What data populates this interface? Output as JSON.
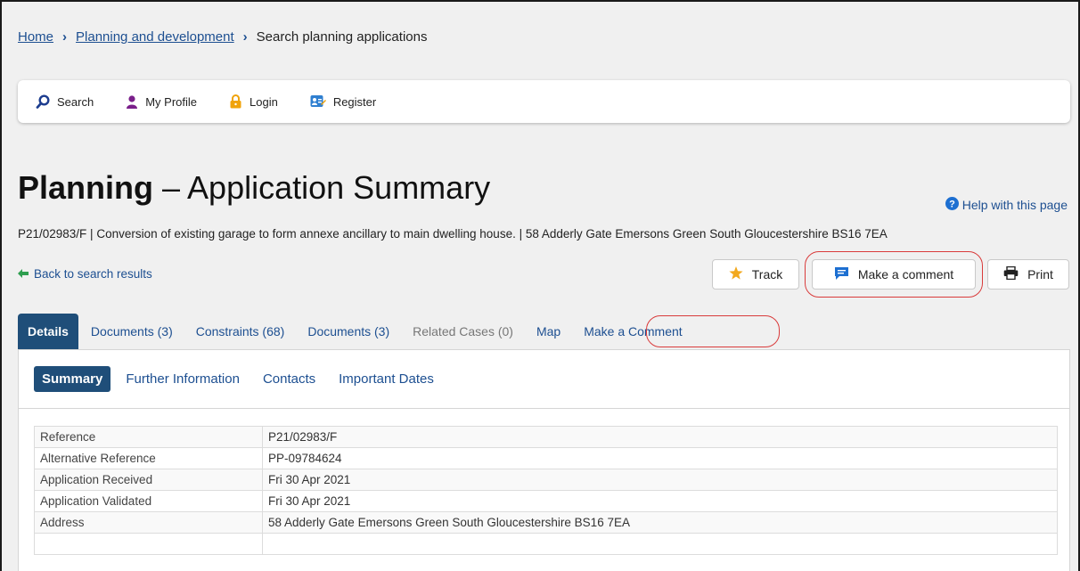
{
  "breadcrumb": {
    "home": "Home",
    "planning": "Planning and development",
    "current": "Search planning applications"
  },
  "topnav": {
    "search": "Search",
    "profile": "My Profile",
    "login": "Login",
    "register": "Register"
  },
  "heading": {
    "bold": "Planning",
    "rest": " – Application Summary"
  },
  "help_link": "Help with this page",
  "description": "P21/02983/F | Conversion of existing garage to form annexe ancillary to main dwelling house. | 58 Adderly Gate Emersons Green South Gloucestershire BS16 7EA",
  "back_link": "Back to search results",
  "actions": {
    "track": "Track",
    "comment": "Make a comment",
    "print": "Print"
  },
  "tabs": {
    "details": "Details",
    "documents_1": "Documents (3)",
    "constraints": "Constraints (68)",
    "documents_2": "Documents (3)",
    "related": "Related Cases (0)",
    "map": "Map",
    "comment": "Make a Comment"
  },
  "subtabs": {
    "summary": "Summary",
    "further": "Further Information",
    "contacts": "Contacts",
    "dates": "Important Dates"
  },
  "details": {
    "rows": [
      {
        "label": "Reference",
        "value": "P21/02983/F"
      },
      {
        "label": "Alternative Reference",
        "value": "PP-09784624"
      },
      {
        "label": "Application Received",
        "value": "Fri 30 Apr 2021"
      },
      {
        "label": "Application Validated",
        "value": "Fri 30 Apr 2021"
      },
      {
        "label": "Address",
        "value": "58 Adderly Gate Emersons Green South Gloucestershire BS16 7EA"
      }
    ]
  },
  "colors": {
    "link": "#1d4f91",
    "active_tab": "#1f4e79",
    "highlight_ring": "#d93b3b",
    "back_arrow": "#2e9e4f",
    "track_star": "#f2a81d"
  }
}
